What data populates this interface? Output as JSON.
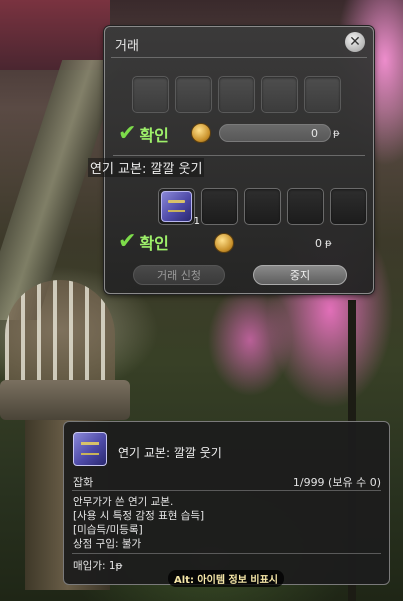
{
  "trade_window": {
    "title": "거래",
    "close_label": "✕",
    "partner": {
      "confirm_label": "확인",
      "gil_amount": "0",
      "gil_symbol": "ᵽ",
      "slot_count": 5
    },
    "own": {
      "confirm_label": "확인",
      "gil_amount": "0",
      "gil_symbol": "ᵽ",
      "slot_count": 5,
      "first_slot_quantity": "1"
    },
    "hover_label": "연기 교본: 깔깔 웃기",
    "buttons": {
      "request": "거래 신청",
      "cancel": "중지"
    }
  },
  "item_tooltip": {
    "name": "연기 교본: 깔깔 웃기",
    "category": "잡화",
    "stack": "1/999 (보유 수 0)",
    "description_lines": [
      "안무가가 쓴 연기 교본.",
      "[사용 시 특정 감정 표현 습득]",
      "[미습득/미등록]",
      "상점 구입: 불가"
    ],
    "sell_price": "매입가: 1ᵽ",
    "alt_hint": "Alt: 아이템 정보 비표시"
  },
  "colors": {
    "confirm_green": "#9ef06a",
    "check_green": "#7ddc4a",
    "window_bg": "#2e2e2e",
    "hint_text": "#f5e6a8"
  },
  "icons": {
    "close": "close-icon",
    "gil": "gil-coin-icon",
    "confirm": "checkmark-icon",
    "item": "purple-book-icon"
  }
}
